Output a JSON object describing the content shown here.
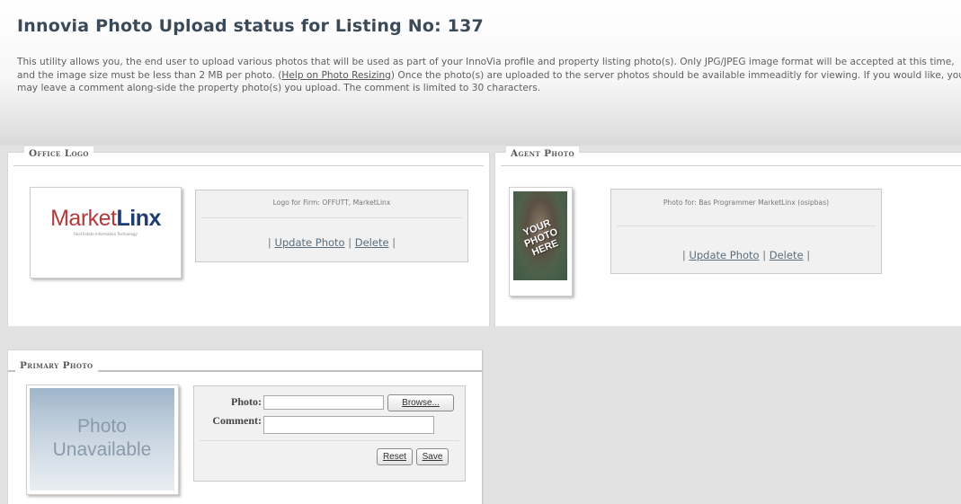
{
  "page": {
    "title": "Innovia Photo Upload status for Listing No: 137",
    "intro": {
      "part1": "This utility allows you, the end user to upload various photos that will be used as part of your InnoVia profile and property listing photo(s). Only JPG/JPEG image format will be accepted at this time, and the image size must be less than 2 MB per photo. (",
      "help_link": "Help on Photo Resizing",
      "part2": ") Once the photo(s) are uploaded to the server photos should be available immeaditly for viewing. If you would like, you may leave a comment along-side the property photo(s) you upload. The comment is limited to 30 characters."
    }
  },
  "office_logo": {
    "legend": "Office Logo",
    "logo_text_1": "Market",
    "logo_text_2": "Linx",
    "logo_tagline": "Real Estate Information Technology",
    "caption": "Logo for Firm: OFFUTT, MarketLinx",
    "sep1": "|",
    "update_label": "Update Photo",
    "sep2": "|",
    "delete_label": "Delete",
    "sep3": "|"
  },
  "agent_photo": {
    "legend": "Agent Photo",
    "placeholder_text": "YOUR PHOTO HERE",
    "caption": "Photo for: Bas Programmer MarketLinx (osipbas)",
    "sep1": "|",
    "update_label": "Update Photo",
    "sep2": "|",
    "delete_label": "Delete",
    "sep3": "|"
  },
  "primary_photo": {
    "legend": "Primary Photo",
    "placeholder_line1": "Photo",
    "placeholder_line2": "Unavailable",
    "photo_label": "Photo:",
    "photo_value": "",
    "browse_label": "Browse...",
    "comment_label": "Comment:",
    "comment_value": "",
    "reset_label": "Reset",
    "save_label": "Save"
  }
}
